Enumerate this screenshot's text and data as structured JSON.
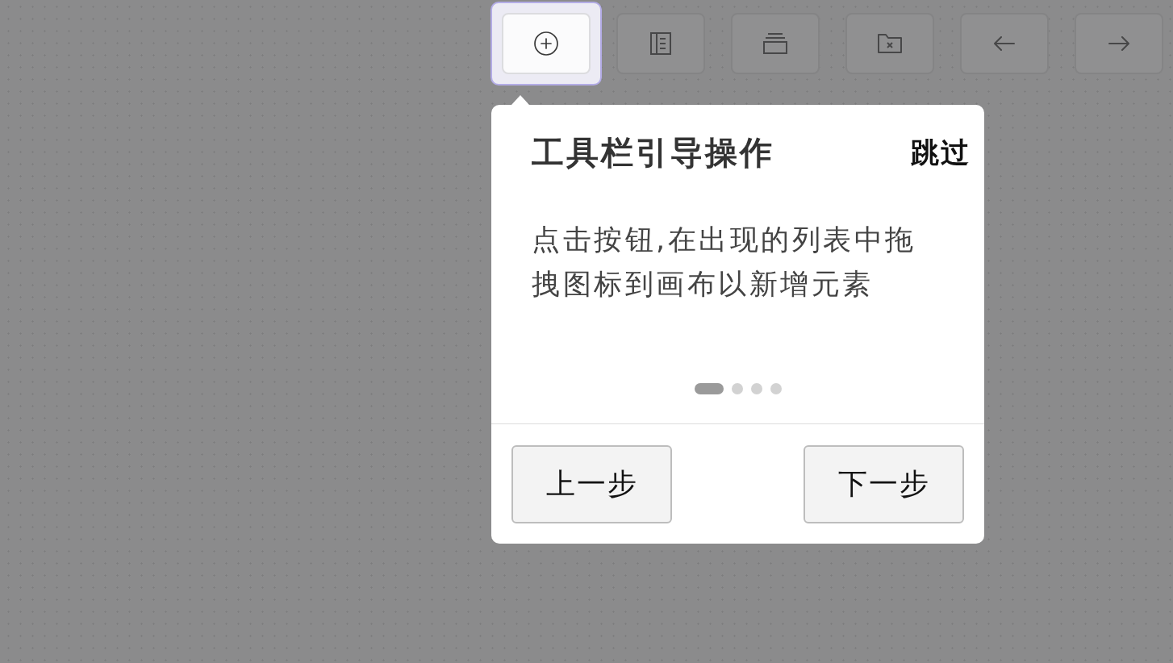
{
  "toolbar": {
    "buttons": [
      {
        "highlighted": true
      },
      {
        "highlighted": false
      },
      {
        "highlighted": false
      },
      {
        "highlighted": false
      },
      {
        "highlighted": false
      },
      {
        "highlighted": false
      }
    ]
  },
  "guide": {
    "title": "工具栏引导操作",
    "skip": "跳过",
    "body": "点击按钮,在出现的列表中拖拽图标到画布以新增元素",
    "steps": [
      {
        "selected": true
      },
      {
        "selected": false
      },
      {
        "selected": false
      },
      {
        "selected": false
      }
    ],
    "buttons": [
      "上一步",
      "下一步"
    ]
  }
}
